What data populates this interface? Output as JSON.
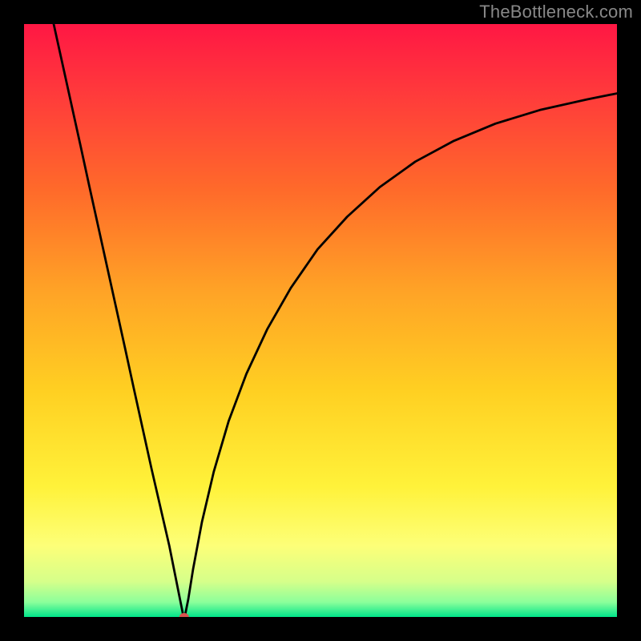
{
  "watermark": "TheBottleneck.com",
  "chart_data": {
    "type": "line",
    "title": "",
    "xlabel": "",
    "ylabel": "",
    "xlim": [
      0,
      100
    ],
    "ylim": [
      0,
      100
    ],
    "grid": false,
    "legend": false,
    "background_gradient": {
      "stops": [
        {
          "offset": 0.0,
          "color": "#ff1744"
        },
        {
          "offset": 0.12,
          "color": "#ff3b3b"
        },
        {
          "offset": 0.28,
          "color": "#ff6a2a"
        },
        {
          "offset": 0.45,
          "color": "#ffa326"
        },
        {
          "offset": 0.62,
          "color": "#ffd022"
        },
        {
          "offset": 0.78,
          "color": "#fff23a"
        },
        {
          "offset": 0.88,
          "color": "#fdff78"
        },
        {
          "offset": 0.94,
          "color": "#d6ff8a"
        },
        {
          "offset": 0.975,
          "color": "#8cff9b"
        },
        {
          "offset": 1.0,
          "color": "#00e58a"
        }
      ]
    },
    "series": [
      {
        "name": "curve-left",
        "x": [
          5.0,
          6.5,
          8.0,
          9.5,
          11.0,
          12.5,
          14.0,
          15.5,
          17.0,
          18.5,
          20.0,
          21.5,
          23.0,
          24.5,
          25.5,
          26.3,
          26.8
        ],
        "y": [
          100.0,
          93.2,
          86.4,
          79.6,
          72.7,
          65.9,
          59.1,
          52.3,
          45.5,
          38.6,
          31.8,
          25.0,
          18.5,
          12.0,
          7.0,
          3.0,
          0.5
        ]
      },
      {
        "name": "curve-right",
        "x": [
          27.2,
          27.7,
          28.5,
          30.0,
          32.0,
          34.5,
          37.5,
          41.0,
          45.0,
          49.5,
          54.5,
          60.0,
          66.0,
          72.5,
          79.5,
          87.0,
          95.0,
          100.0
        ],
        "y": [
          0.5,
          3.0,
          8.0,
          16.0,
          24.5,
          33.0,
          41.0,
          48.5,
          55.5,
          62.0,
          67.5,
          72.5,
          76.8,
          80.3,
          83.2,
          85.5,
          87.3,
          88.3
        ]
      }
    ],
    "marker": {
      "name": "valley-marker",
      "x": 27.0,
      "y": 0.0,
      "color": "#d9534f",
      "rx": 6,
      "ry": 5
    }
  }
}
